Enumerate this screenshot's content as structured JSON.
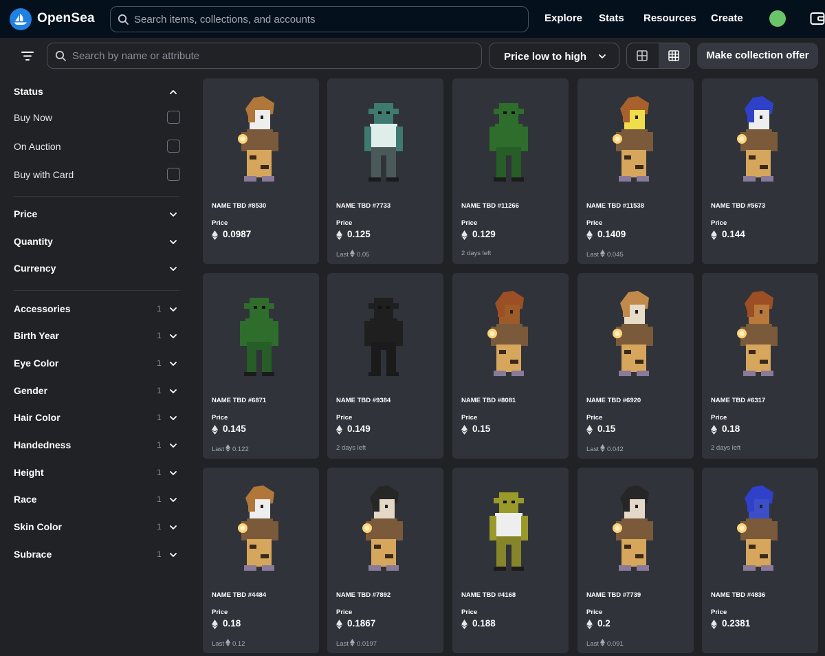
{
  "topbar": {
    "brand": "OpenSea",
    "search_placeholder": "Search items, collections, and accounts",
    "nav": [
      "Explore",
      "Stats",
      "Resources",
      "Create"
    ]
  },
  "toolbar": {
    "search_placeholder": "Search by name or attribute",
    "sort_label": "Price low to high",
    "offer_label": "Make collection offer"
  },
  "sidebar": {
    "status_title": "Status",
    "status_options": [
      "Buy Now",
      "On Auction",
      "Buy with Card"
    ],
    "filters": [
      "Price",
      "Quantity",
      "Currency"
    ],
    "traits": [
      {
        "name": "Accessories",
        "count": "1"
      },
      {
        "name": "Birth Year",
        "count": "1"
      },
      {
        "name": "Eye Color",
        "count": "1"
      },
      {
        "name": "Gender",
        "count": "1"
      },
      {
        "name": "Hair Color",
        "count": "1"
      },
      {
        "name": "Handedness",
        "count": "1"
      },
      {
        "name": "Height",
        "count": "1"
      },
      {
        "name": "Race",
        "count": "1"
      },
      {
        "name": "Skin Color",
        "count": "1"
      },
      {
        "name": "Subrace",
        "count": "1"
      }
    ]
  },
  "items": [
    {
      "name": "NAME TBD #8530",
      "price_label": "Price",
      "price": "0.0987",
      "footer": "",
      "last": ""
    },
    {
      "name": "NAME TBD #7733",
      "price_label": "Price",
      "price": "0.125",
      "footer": "Last",
      "last": "0.05"
    },
    {
      "name": "NAME TBD #11266",
      "price_label": "Price",
      "price": "0.129",
      "footer": "2 days left",
      "last": ""
    },
    {
      "name": "NAME TBD #11538",
      "price_label": "Price",
      "price": "0.1409",
      "footer": "Last",
      "last": "0.045"
    },
    {
      "name": "NAME TBD #5673",
      "price_label": "Price",
      "price": "0.144",
      "footer": "",
      "last": ""
    },
    {
      "name": "NAME TBD #6871",
      "price_label": "Price",
      "price": "0.145",
      "footer": "Last",
      "last": "0.122"
    },
    {
      "name": "NAME TBD #9384",
      "price_label": "Price",
      "price": "0.149",
      "footer": "2 days left",
      "last": ""
    },
    {
      "name": "NAME TBD #8081",
      "price_label": "Price",
      "price": "0.15",
      "footer": "",
      "last": ""
    },
    {
      "name": "NAME TBD #6920",
      "price_label": "Price",
      "price": "0.15",
      "footer": "Last",
      "last": "0.042"
    },
    {
      "name": "NAME TBD #6317",
      "price_label": "Price",
      "price": "0.18",
      "footer": "2 days left",
      "last": ""
    },
    {
      "name": "NAME TBD #4484",
      "price_label": "Price",
      "price": "0.18",
      "footer": "Last",
      "last": "0.12"
    },
    {
      "name": "NAME TBD #7892",
      "price_label": "Price",
      "price": "0.1867",
      "footer": "Last",
      "last": "0.0197"
    },
    {
      "name": "NAME TBD #4168",
      "price_label": "Price",
      "price": "0.188",
      "footer": "",
      "last": ""
    },
    {
      "name": "NAME TBD #7739",
      "price_label": "Price",
      "price": "0.2",
      "footer": "Last",
      "last": "0.091"
    },
    {
      "name": "NAME TBD #4836",
      "price_label": "Price",
      "price": "0.2381",
      "footer": "",
      "last": ""
    }
  ],
  "sprites": [
    {
      "race": "human",
      "hair": "#b0763a",
      "skin": "#eeeeee"
    },
    {
      "race": "orc",
      "skin": "#3f7a70",
      "shirt": "#dfeee8",
      "pants": "#4a5a5a"
    },
    {
      "race": "orc",
      "skin": "#2f6d2d",
      "shirt": "#2f6d2d",
      "pants": "#275d26"
    },
    {
      "race": "human",
      "hair": "#a8612c",
      "skin": "#f0dd4a"
    },
    {
      "race": "human",
      "hair": "#2f40c9",
      "skin": "#eeeeee"
    },
    {
      "race": "orc",
      "skin": "#2f6d2d",
      "shirt": "#2f6d2d",
      "pants": "#275d26"
    },
    {
      "race": "orc",
      "skin": "#1f1f1f",
      "shirt": "#1f1f1f",
      "pants": "#1b1b1b"
    },
    {
      "race": "human",
      "hair": "#9c4e25",
      "skin": "#9e5b2a"
    },
    {
      "race": "human",
      "hair": "#c28a4a",
      "skin": "#e6dcc9"
    },
    {
      "race": "human",
      "hair": "#9c4e25",
      "skin": "#b9793c"
    },
    {
      "race": "human",
      "hair": "#b0763a",
      "skin": "#eeeeee"
    },
    {
      "race": "human",
      "hair": "#262626",
      "skin": "#e4d8c6"
    },
    {
      "race": "orc",
      "skin": "#9a9a2a",
      "shirt": "#eeeeee",
      "pants": "#86852a"
    },
    {
      "race": "human",
      "hair": "#262626",
      "skin": "#e4d8c6"
    },
    {
      "race": "human",
      "hair": "#2f40c9",
      "skin": "#3d4ec9"
    }
  ]
}
